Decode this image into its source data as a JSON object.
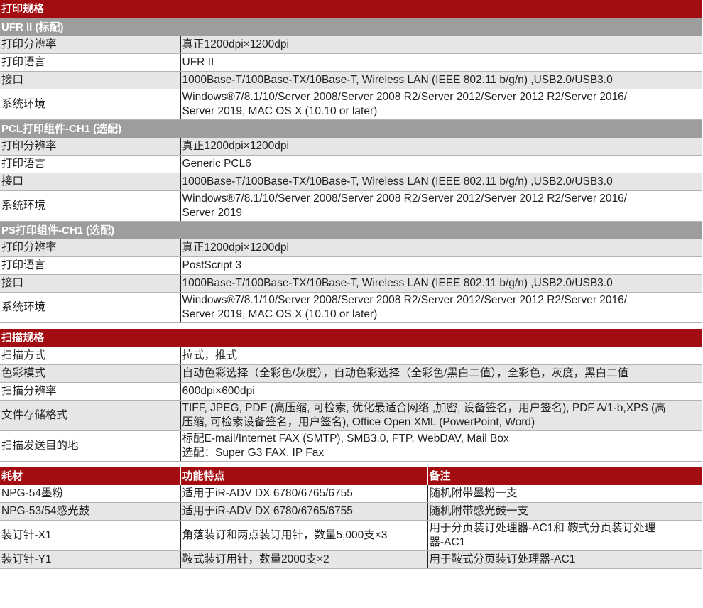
{
  "print": {
    "header": "打印规格",
    "groups": [
      {
        "title": "UFR II (标配)",
        "rows": [
          {
            "k": "打印分辨率",
            "v": "真正1200dpi×1200dpi",
            "shade": true
          },
          {
            "k": "打印语言",
            "v": "UFR II",
            "shade": false
          },
          {
            "k": "接口",
            "v": "1000Base-T/100Base-TX/10Base-T, Wireless LAN (IEEE 802.11 b/g/n) ,USB2.0/USB3.0",
            "shade": true
          },
          {
            "k": "系统环境",
            "v": "Windows®7/8.1/10/Server 2008/Server 2008 R2/Server 2012/Server 2012 R2/Server 2016/",
            "v2": "Server 2019, MAC OS X (10.10 or later)",
            "shade": false
          }
        ]
      },
      {
        "title": "PCL打印组件-CH1 (选配)",
        "rows": [
          {
            "k": "打印分辨率",
            "v": "真正1200dpi×1200dpi",
            "shade": true
          },
          {
            "k": "打印语言",
            "v": "Generic PCL6",
            "shade": false
          },
          {
            "k": "接口",
            "v": "1000Base-T/100Base-TX/10Base-T, Wireless LAN (IEEE 802.11 b/g/n) ,USB2.0/USB3.0",
            "shade": true
          },
          {
            "k": "系统环境",
            "v": "Windows®7/8.1/10/Server 2008/Server 2008 R2/Server 2012/Server 2012 R2/Server 2016/",
            "v2": "Server 2019",
            "shade": false
          }
        ]
      },
      {
        "title": "PS打印组件-CH1 (选配)",
        "rows": [
          {
            "k": "打印分辨率",
            "v": "真正1200dpi×1200dpi",
            "shade": true
          },
          {
            "k": "打印语言",
            "v": "PostScript 3",
            "shade": false
          },
          {
            "k": "接口",
            "v": "1000Base-T/100Base-TX/10Base-T, Wireless LAN (IEEE 802.11 b/g/n) ,USB2.0/USB3.0",
            "shade": true
          },
          {
            "k": "系统环境",
            "v": "Windows®7/8.1/10/Server 2008/Server 2008 R2/Server 2012/Server 2012 R2/Server 2016/",
            "v2": "Server 2019, MAC OS X (10.10 or later)",
            "shade": false
          }
        ]
      }
    ]
  },
  "scan": {
    "header": "扫描规格",
    "rows": [
      {
        "k": "扫描方式",
        "v": "拉式，推式",
        "shade": false
      },
      {
        "k": "色彩模式",
        "v": "自动色彩选择（全彩色/灰度），自动色彩选择（全彩色/黑白二值），全彩色，灰度，黑白二值",
        "shade": true
      },
      {
        "k": "扫描分辨率",
        "v": "600dpi×600dpi",
        "shade": false
      },
      {
        "k": "文件存储格式",
        "v": "TIFF, JPEG, PDF (高压缩, 可检索, 优化最适合网络 ,加密, 设备签名，用户签名), PDF A/1-b,XPS (高",
        "v2": "压缩, 可检索设备签名，用户签名), Office Open XML (PowerPoint, Word)",
        "shade": true
      },
      {
        "k": "扫描发送目的地",
        "v": "标配E-mail/Internet FAX (SMTP), SMB3.0, FTP, WebDAV, Mail Box",
        "v2": "选配：Super G3 FAX, IP Fax",
        "shade": false
      }
    ]
  },
  "consumables": {
    "headers": [
      "耗材",
      "功能特点",
      "备注"
    ],
    "rows": [
      {
        "name": "NPG-54墨粉",
        "feature": "适用于iR-ADV DX 6780/6765/6755",
        "note": "随机附带墨粉一支",
        "note2": "",
        "shade": false
      },
      {
        "name": "NPG-53/54感光鼓",
        "feature": "适用于iR-ADV DX 6780/6765/6755",
        "note": "随机附带感光鼓一支",
        "note2": "",
        "shade": true
      },
      {
        "name": "装订针-X1",
        "feature": "角落装订和两点装订用针，数量5,000支×3",
        "note": "用于分页装订处理器-AC1和 鞍式分页装订处理",
        "note2": "器-AC1",
        "shade": false
      },
      {
        "name": "装订针-Y1",
        "feature": "鞍式装订用针，数量2000支×2",
        "note": "用于鞍式分页装订处理器-AC1",
        "note2": "",
        "shade": true
      }
    ]
  }
}
